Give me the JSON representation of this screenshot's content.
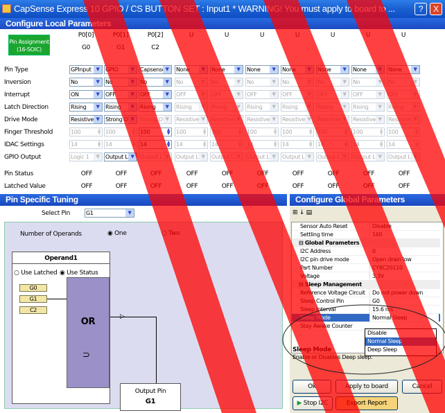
{
  "window": {
    "title": "CapSense Express 10 GPIO / CS BUTTON SET : Input1 * WARNING! You must apply to board to ...",
    "help_label": "?",
    "close_label": "X"
  },
  "local": {
    "header": "Configure Local Parameters",
    "pin_assignment": "Pin Assignment (16-SOIC)",
    "columns": [
      {
        "top": "P0[0]",
        "bottom": "G0"
      },
      {
        "top": "P0[1]",
        "bottom": "G1"
      },
      {
        "top": "P0[2]",
        "bottom": "C2"
      },
      {
        "top": "U",
        "bottom": ""
      },
      {
        "top": "U",
        "bottom": ""
      },
      {
        "top": "U",
        "bottom": ""
      },
      {
        "top": "U",
        "bottom": ""
      },
      {
        "top": "U",
        "bottom": ""
      },
      {
        "top": "U",
        "bottom": ""
      },
      {
        "top": "U",
        "bottom": ""
      }
    ],
    "row_labels": [
      "Pin Type",
      "Inversion",
      "Interrupt",
      "Latch Direction",
      "Drive Mode",
      "Finger Threshold",
      "IDAC Settings",
      "GPIO Output"
    ],
    "rows": [
      [
        "GPInput",
        "GPIO",
        "Capsense",
        "None",
        "None",
        "None",
        "None",
        "None",
        "None",
        "None"
      ],
      [
        "No",
        "No",
        "No",
        "No",
        "No",
        "No",
        "No",
        "No",
        "No",
        "No"
      ],
      [
        "ON",
        "OFF",
        "OFF",
        "OFF",
        "OFF",
        "OFF",
        "OFF",
        "OFF",
        "OFF",
        "OFF"
      ],
      [
        "Rising",
        "Rising",
        "Rising",
        "Rising",
        "Rising",
        "Rising",
        "Rising",
        "Rising",
        "Rising",
        "Rising"
      ],
      [
        "Resistive",
        "Strong D",
        "Strong D",
        "Resistive",
        "Resistive",
        "Resistive",
        "Resistive",
        "Resistive",
        "Resistive",
        "Resistive"
      ],
      [
        "100",
        "100",
        "100",
        "100",
        "100",
        "100",
        "100",
        "100",
        "100",
        "100"
      ],
      [
        "14",
        "14",
        "14",
        "14",
        "14",
        "14",
        "14",
        "14",
        "14",
        "14"
      ],
      [
        "Logic 1",
        "Output L",
        "Output L",
        "Output L",
        "Output L",
        "Output L",
        "Output L",
        "Output L",
        "Output L",
        "Output L"
      ]
    ],
    "status_label": "Pin Status",
    "latched_label": "Latched Value",
    "status": [
      "OFF",
      "OFF",
      "OFF",
      "OFF",
      "OFF",
      "OFF",
      "OFF",
      "OFF",
      "OFF",
      "OFF"
    ],
    "latched": [
      "OFF",
      "OFF",
      "OFF",
      "OFF",
      "OFF",
      "OFF",
      "OFF",
      "OFF",
      "OFF",
      "OFF"
    ]
  },
  "tuning": {
    "header": "Pin Specific Tuning",
    "select_label": "Select Pin",
    "select_value": "G1",
    "operands_label": "Number of Operands",
    "opt_one": "One",
    "opt_two": "Two",
    "operand_title": "Operand1",
    "use_latched": "Use Latched",
    "use_status": "Use Status",
    "inputs": [
      "G0",
      "G1",
      "C2"
    ],
    "gate": "OR",
    "output_label": "Output Pin",
    "output_value": "G1"
  },
  "global": {
    "header": "Configure Global Parameters",
    "rows": [
      {
        "k": "Sensor Auto Reset",
        "v": "Disable",
        "cat": false
      },
      {
        "k": "Settling time",
        "v": "160",
        "cat": false
      },
      {
        "k": "Global Parameters",
        "v": "",
        "cat": true
      },
      {
        "k": "I2C Address",
        "v": "0",
        "cat": false
      },
      {
        "k": "I2C pin drive mode",
        "v": "Open drain low",
        "cat": false
      },
      {
        "k": "Part Number",
        "v": "CY8C20110",
        "cat": false
      },
      {
        "k": "Voltage",
        "v": "3.3V",
        "cat": false
      },
      {
        "k": "Sleep Management",
        "v": "",
        "cat": true
      },
      {
        "k": "Reference Voltage Circuit",
        "v": "Do not power down",
        "cat": false
      },
      {
        "k": "Sleep Control Pin",
        "v": "G0",
        "cat": false
      },
      {
        "k": "Sleep Interval",
        "v": "15.6 ms",
        "cat": false
      },
      {
        "k": "Sleep Mode",
        "v": "Normal Sleep",
        "cat": false
      },
      {
        "k": "Stay Awake Counter",
        "v": "",
        "cat": false
      }
    ],
    "dropdown_options": [
      "Disable",
      "Normal Sleep",
      "Deep Sleep"
    ],
    "desc_title": "Sleep Mode",
    "desc_text": "Enable or Disables Deep sleep.",
    "ok": "Ok",
    "apply": "Apply to board",
    "cancel": "Cancel",
    "stop": "Stop I2C",
    "export": "Export Report"
  },
  "colors": {
    "title": "#1a5fd0",
    "pin_assign": "#1ba62f",
    "warning_band": "#ff0000",
    "selected": "#316ac5"
  }
}
